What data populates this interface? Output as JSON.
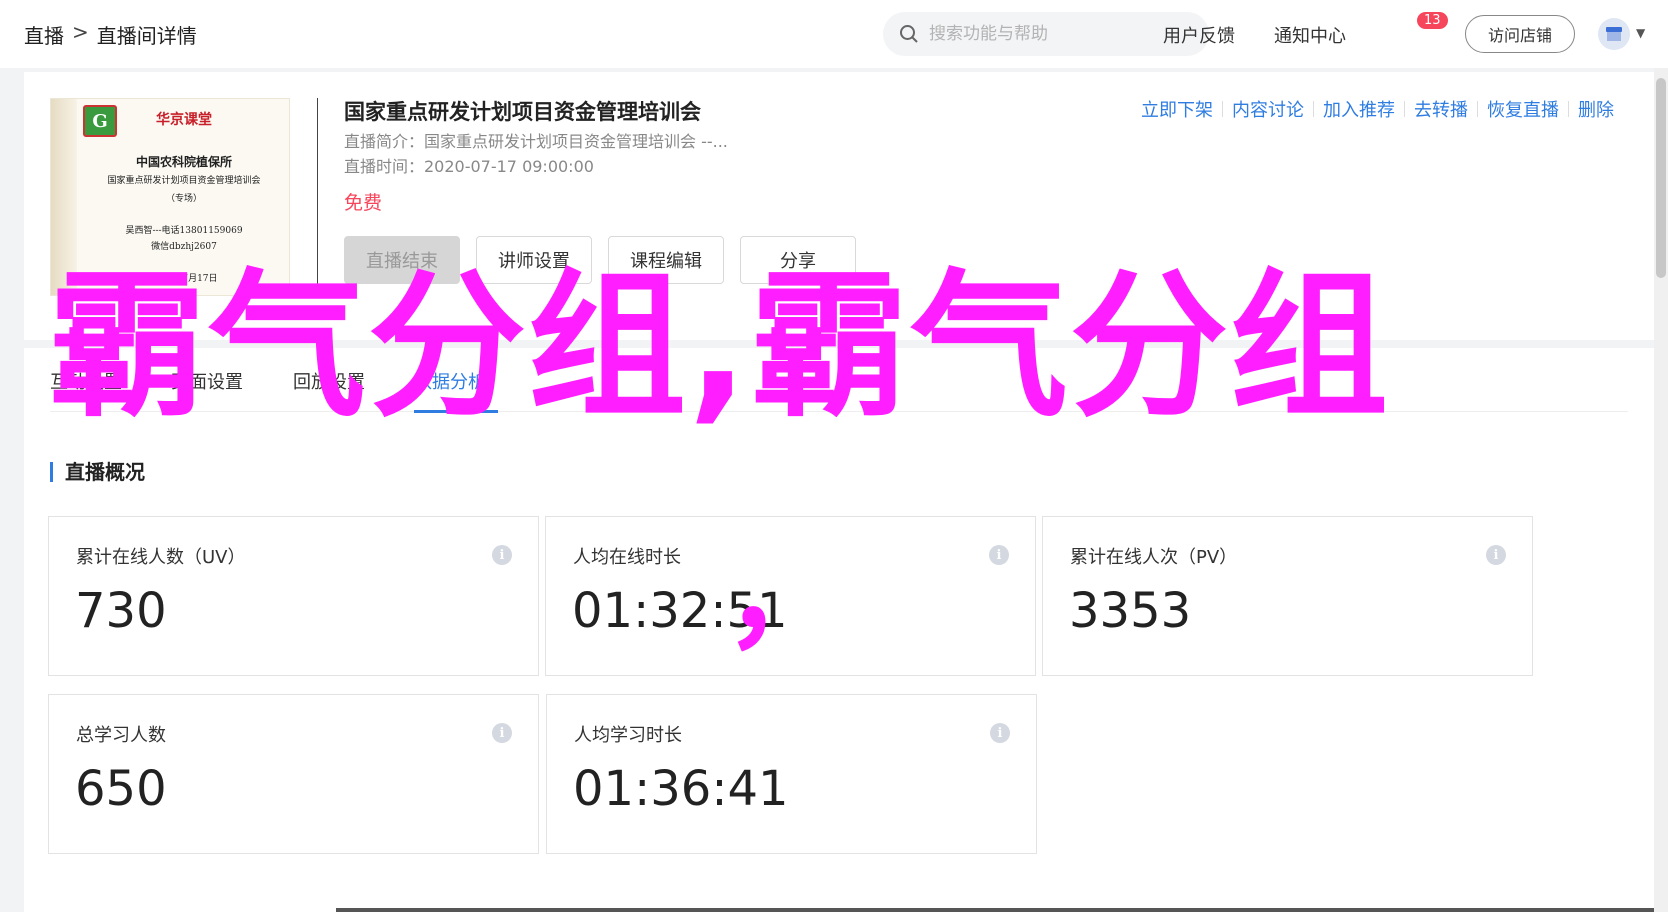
{
  "header": {
    "breadcrumb_root": "直播",
    "breadcrumb_sep": ">",
    "breadcrumb_current": "直播间详情",
    "search_placeholder": "搜索功能与帮助",
    "feedback": "用户反馈",
    "notice": "通知中心",
    "notice_count": "13",
    "visit_store": "访问店铺"
  },
  "cover": {
    "brand": "华京课堂",
    "org": "中国农科院植保所",
    "subject": "国家重点研发计划项目资金管理培训会",
    "note": "（专场）",
    "contact1": "吴西智---电话13801159069",
    "contact2": "微信dbzhj2607",
    "date": "2020年7月17日"
  },
  "course": {
    "title": "国家重点研发计划项目资金管理培训会",
    "intro": "直播简介：国家重点研发计划项目资金管理培训会 --...",
    "time": "直播时间：2020-07-17 09:00:00",
    "price": "免费"
  },
  "actions": [
    "立即下架",
    "内容讨论",
    "加入推荐",
    "去转播",
    "恢复直播",
    "删除"
  ],
  "buttons": {
    "end_live": "直播结束",
    "teacher": "讲师设置",
    "course_edit": "课程编辑",
    "share": "分享"
  },
  "tabs": [
    "互动设置",
    "页面设置",
    "回放设置",
    "数据分析"
  ],
  "section_title": "直播概况",
  "stats": [
    {
      "label": "累计在线人数（UV）",
      "value": "730"
    },
    {
      "label": "人均在线时长",
      "value": "01:32:51"
    },
    {
      "label": "累计在线人次（PV）",
      "value": "3353"
    },
    {
      "label": "总学习人数",
      "value": "650"
    },
    {
      "label": "人均学习时长",
      "value": "01:36:41"
    }
  ],
  "watermark": "霸气分组,霸气分组",
  "watermark_comma": "，",
  "colors": {
    "accent": "#2f7de1",
    "price": "#f5465b",
    "watermark": "#ff1eff"
  }
}
